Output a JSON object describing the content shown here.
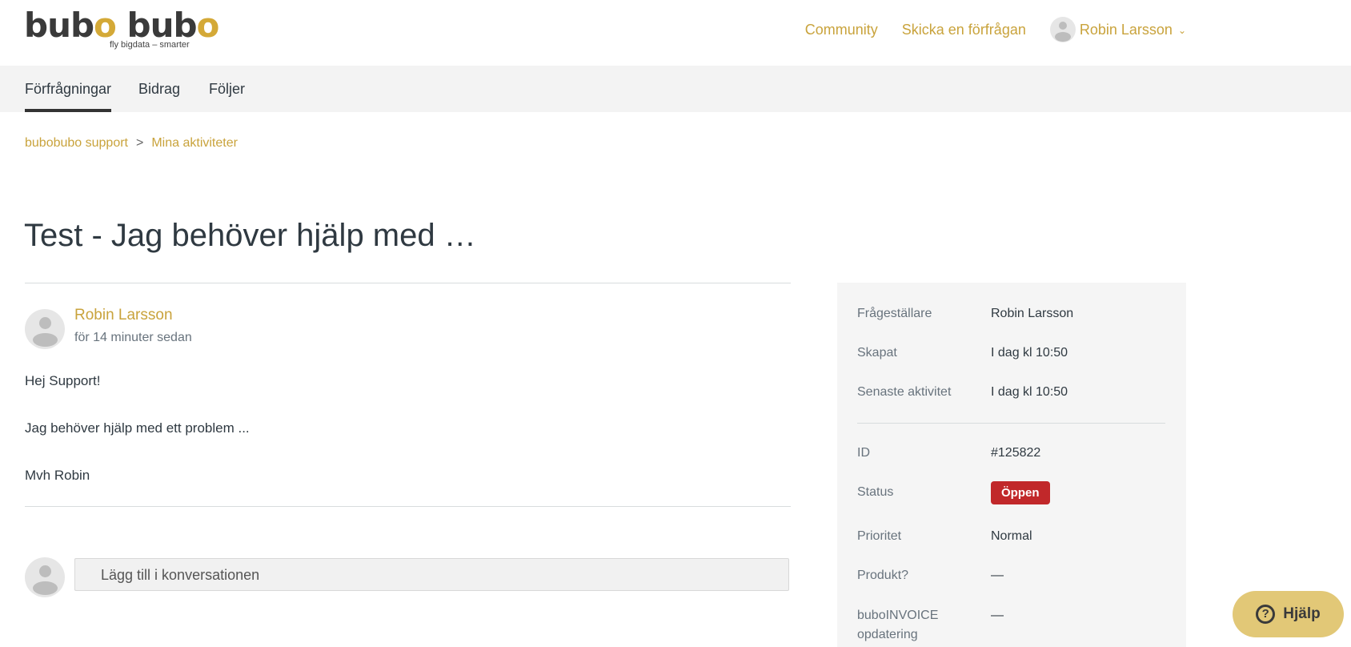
{
  "header": {
    "logo": {
      "word1_a": "bub",
      "word1_b": "o",
      "word2_a": "bub",
      "word2_b": "o",
      "tagline": "fly bigdata – smarter"
    },
    "nav": {
      "community": "Community",
      "request": "Skicka en förfrågan"
    },
    "user": {
      "name": "Robin Larsson",
      "chevron": "⌄"
    }
  },
  "subnav": {
    "tabs": [
      "Förfrågningar",
      "Bidrag",
      "Följer"
    ],
    "active_index": 0
  },
  "breadcrumb": {
    "items": [
      "bubobubo support",
      "Mina aktiviteter"
    ],
    "separator": ">"
  },
  "request": {
    "title": "Test - Jag behöver hjälp med …",
    "author": "Robin Larsson",
    "timestamp": "för 14 minuter sedan",
    "body": [
      "Hej Support!",
      "Jag behöver hjälp med ett problem ...",
      "Mvh Robin"
    ],
    "reply_placeholder": "Lägg till i konversationen"
  },
  "sidebar": {
    "requester": {
      "label": "Frågeställare",
      "value": "Robin Larsson"
    },
    "created": {
      "label": "Skapat",
      "value": "I dag kl 10:50"
    },
    "last_activity": {
      "label": "Senaste aktivitet",
      "value": "I dag kl 10:50"
    },
    "id": {
      "label": "ID",
      "value": "#125822"
    },
    "status": {
      "label": "Status",
      "value": "Öppen"
    },
    "priority": {
      "label": "Prioritet",
      "value": "Normal"
    },
    "product": {
      "label": "Produkt?",
      "value": "—"
    },
    "invoice": {
      "label": "buboINVOICE opdatering",
      "value": "—"
    }
  },
  "help": {
    "label": "Hjälp",
    "icon": "?"
  },
  "colors": {
    "accent": "#c9a33c",
    "status_open": "#c1282a",
    "help_bg": "#e2c877"
  },
  "icons": {
    "user_avatar": "user-avatar-icon",
    "help": "question-circle-icon"
  }
}
